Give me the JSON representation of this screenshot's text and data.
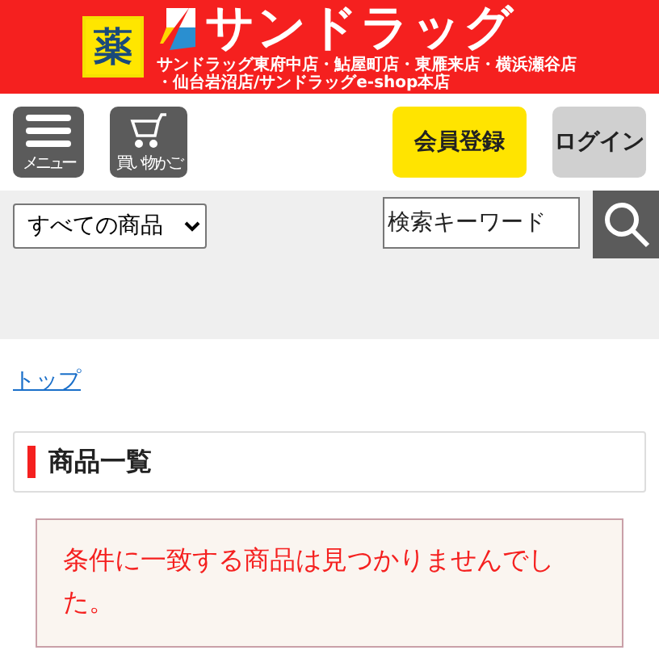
{
  "header": {
    "kusuri_mark": "薬",
    "brand": "サンドラッグ",
    "stores_line1": "サンドラッグ東府中店・鮎屋町店・東雁来店・横浜瀬谷店",
    "stores_line2": "・仙台岩沼店/サンドラッグe-shop本店"
  },
  "nav": {
    "menu_label": "メニュー",
    "cart_label": "買い物かご",
    "register": "会員登録",
    "login": "ログイン"
  },
  "search": {
    "category": "すべての商品",
    "placeholder": "検索キーワード"
  },
  "breadcrumb": [
    {
      "label": "トップ"
    }
  ],
  "page_title": "商品一覧",
  "message": "条件に一致する商品は見つかりませんでした。"
}
